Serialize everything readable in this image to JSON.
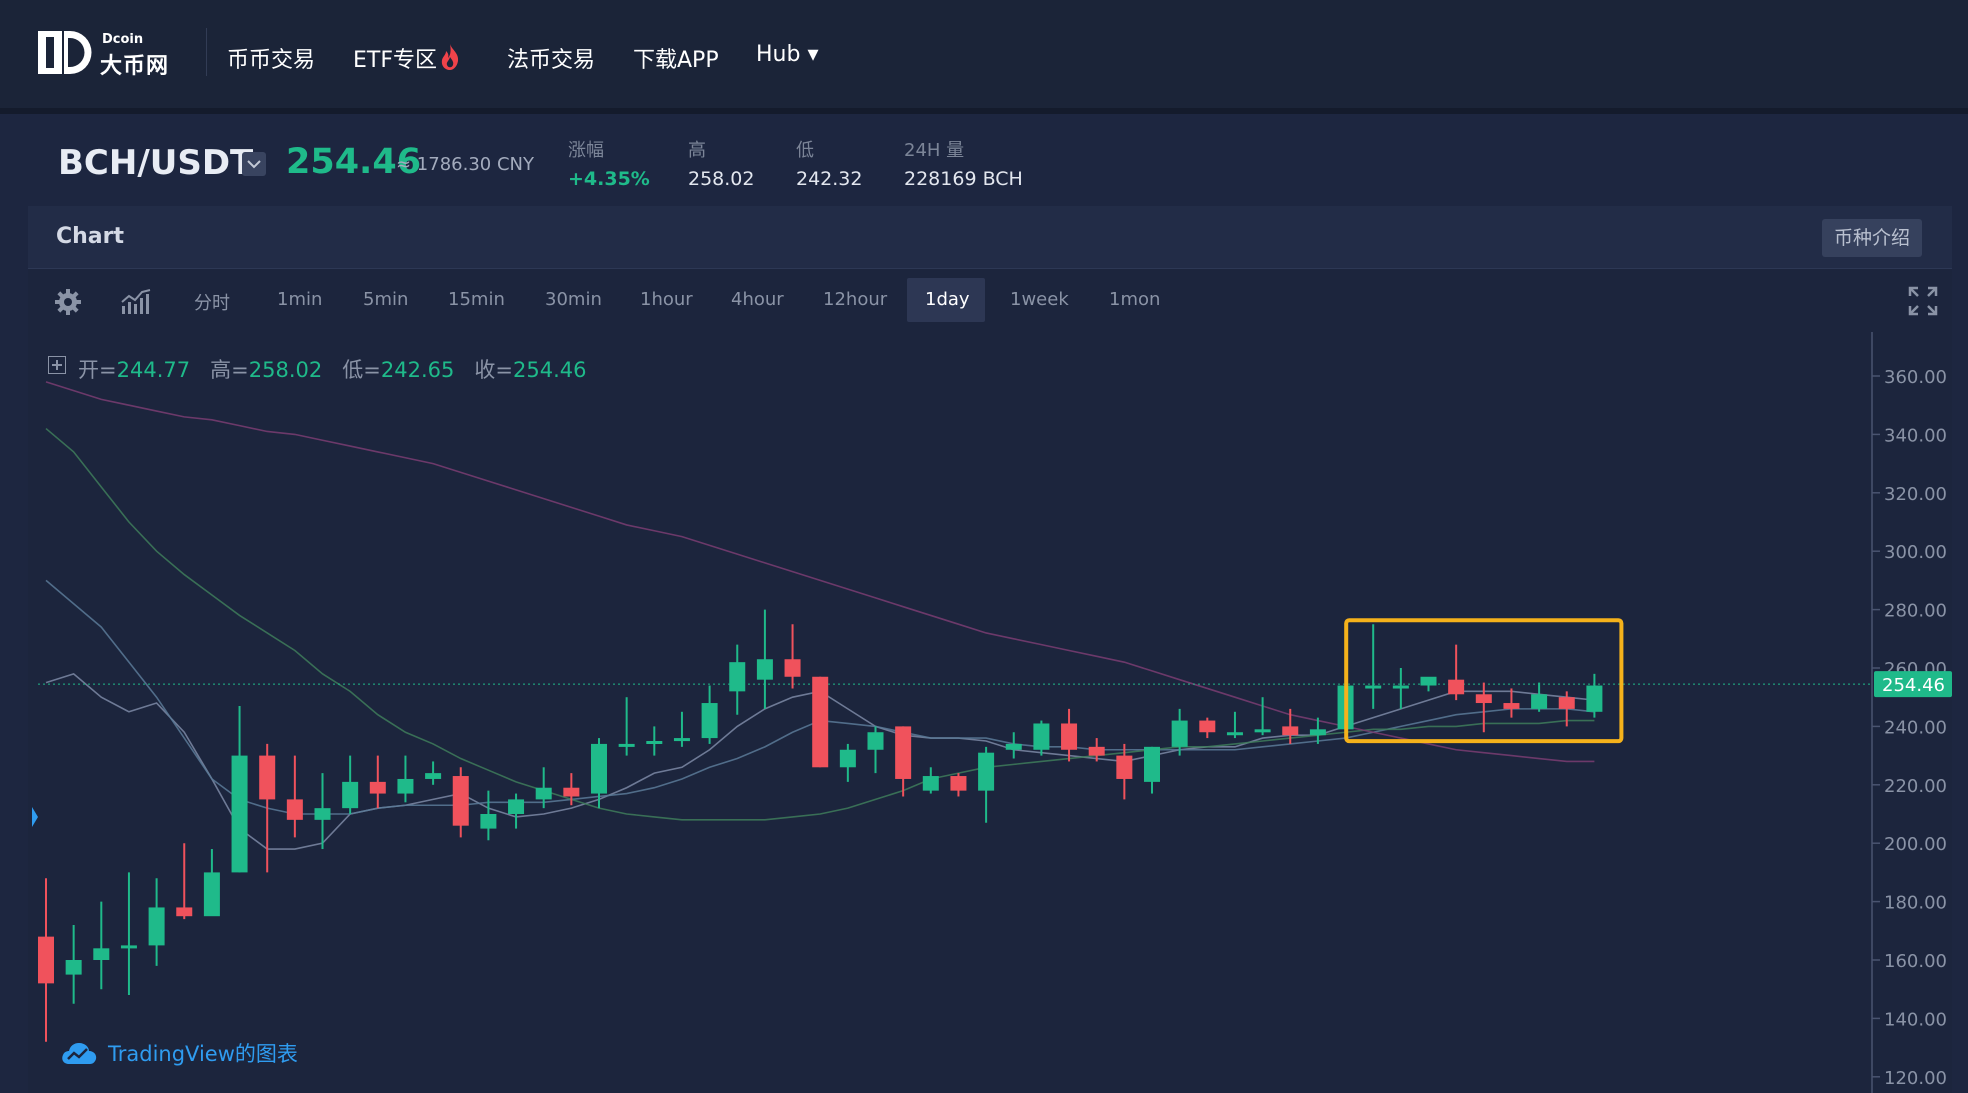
{
  "nav": {
    "logo_small": "Dcoin",
    "logo_big": "大币网",
    "items": [
      {
        "label": "币币交易"
      },
      {
        "label": "ETF专区"
      },
      {
        "label": "法币交易"
      },
      {
        "label": "下载APP"
      },
      {
        "label": "Hub ▾"
      }
    ]
  },
  "ticker": {
    "pair": "BCH/USDT",
    "last_price": "254.46",
    "cny": "≈ 1786.30 CNY",
    "change_label": "涨幅",
    "change_value": "+4.35%",
    "high_label": "高",
    "high_value": "258.02",
    "low_label": "低",
    "low_value": "242.32",
    "vol_label": "24H 量",
    "vol_value": "228169 BCH"
  },
  "chart_panel": {
    "title": "Chart",
    "intro_button": "币种介绍",
    "intervals": [
      "分时",
      "1min",
      "5min",
      "15min",
      "30min",
      "1hour",
      "4hour",
      "12hour",
      "1day",
      "1week",
      "1mon"
    ],
    "active_interval": "1day",
    "legend": {
      "open_label": "开=",
      "open_value": "244.77",
      "high_label": "高=",
      "high_value": "258.02",
      "low_label": "低=",
      "low_value": "242.65",
      "close_label": "收=",
      "close_value": "254.46"
    },
    "watermark": "TradingView的图表",
    "colors": {
      "up": "#1fba8a",
      "down": "#f0525c",
      "highlight": "#f5b21b",
      "ma5": "#7c8aa6",
      "ma10": "#5b7a98",
      "ma30": "#3e7c5a",
      "ma60": "#7a3d72"
    }
  },
  "chart_data": {
    "type": "candlestick",
    "price_axis": [
      "360.00",
      "340.00",
      "320.00",
      "300.00",
      "280.00",
      "260.00",
      "240.00",
      "220.00",
      "200.00",
      "180.00",
      "160.00",
      "140.00",
      "120.00"
    ],
    "last_price_label": "254.46",
    "ylim": [
      120,
      368
    ],
    "candles": [
      {
        "o": 168,
        "h": 188,
        "l": 132,
        "c": 152
      },
      {
        "o": 155,
        "h": 172,
        "l": 145,
        "c": 160
      },
      {
        "o": 160,
        "h": 180,
        "l": 150,
        "c": 164
      },
      {
        "o": 164,
        "h": 190,
        "l": 148,
        "c": 165
      },
      {
        "o": 165,
        "h": 188,
        "l": 158,
        "c": 178
      },
      {
        "o": 178,
        "h": 200,
        "l": 174,
        "c": 175
      },
      {
        "o": 175,
        "h": 198,
        "l": 178,
        "c": 190
      },
      {
        "o": 190,
        "h": 247,
        "l": 190,
        "c": 230
      },
      {
        "o": 230,
        "h": 234,
        "l": 190,
        "c": 215
      },
      {
        "o": 215,
        "h": 230,
        "l": 202,
        "c": 208
      },
      {
        "o": 208,
        "h": 224,
        "l": 198,
        "c": 212
      },
      {
        "o": 212,
        "h": 230,
        "l": 210,
        "c": 221
      },
      {
        "o": 221,
        "h": 230,
        "l": 212,
        "c": 217
      },
      {
        "o": 217,
        "h": 230,
        "l": 214,
        "c": 222
      },
      {
        "o": 222,
        "h": 228,
        "l": 220,
        "c": 224
      },
      {
        "o": 223,
        "h": 226,
        "l": 202,
        "c": 206
      },
      {
        "o": 205,
        "h": 218,
        "l": 201,
        "c": 210
      },
      {
        "o": 210,
        "h": 217,
        "l": 205,
        "c": 215
      },
      {
        "o": 215,
        "h": 226,
        "l": 212,
        "c": 219
      },
      {
        "o": 219,
        "h": 224,
        "l": 213,
        "c": 216
      },
      {
        "o": 217,
        "h": 236,
        "l": 212,
        "c": 234
      },
      {
        "o": 234,
        "h": 250,
        "l": 230,
        "c": 234
      },
      {
        "o": 234,
        "h": 240,
        "l": 230,
        "c": 235
      },
      {
        "o": 235,
        "h": 245,
        "l": 233,
        "c": 236
      },
      {
        "o": 236,
        "h": 254,
        "l": 234,
        "c": 248
      },
      {
        "o": 252,
        "h": 268,
        "l": 244,
        "c": 262
      },
      {
        "o": 256,
        "h": 280,
        "l": 246,
        "c": 263
      },
      {
        "o": 263,
        "h": 275,
        "l": 253,
        "c": 257
      },
      {
        "o": 257,
        "h": 257,
        "l": 226,
        "c": 226
      },
      {
        "o": 226,
        "h": 234,
        "l": 221,
        "c": 232
      },
      {
        "o": 232,
        "h": 240,
        "l": 224,
        "c": 238
      },
      {
        "o": 240,
        "h": 240,
        "l": 216,
        "c": 222
      },
      {
        "o": 218,
        "h": 226,
        "l": 217,
        "c": 223
      },
      {
        "o": 223,
        "h": 224,
        "l": 216,
        "c": 218
      },
      {
        "o": 218,
        "h": 233,
        "l": 207,
        "c": 231
      },
      {
        "o": 232,
        "h": 238,
        "l": 229,
        "c": 234
      },
      {
        "o": 232,
        "h": 242,
        "l": 230,
        "c": 241
      },
      {
        "o": 241,
        "h": 246,
        "l": 228,
        "c": 232
      },
      {
        "o": 233,
        "h": 236,
        "l": 228,
        "c": 230
      },
      {
        "o": 230,
        "h": 234,
        "l": 215,
        "c": 222
      },
      {
        "o": 221,
        "h": 233,
        "l": 217,
        "c": 233
      },
      {
        "o": 233,
        "h": 246,
        "l": 230,
        "c": 242
      },
      {
        "o": 242,
        "h": 243,
        "l": 236,
        "c": 238
      },
      {
        "o": 238,
        "h": 245,
        "l": 236,
        "c": 238
      },
      {
        "o": 238,
        "h": 250,
        "l": 237,
        "c": 239
      },
      {
        "o": 240,
        "h": 246,
        "l": 234,
        "c": 237
      },
      {
        "o": 237,
        "h": 243,
        "l": 234,
        "c": 239
      },
      {
        "o": 239,
        "h": 250,
        "l": 237,
        "c": 254
      },
      {
        "o": 254,
        "h": 275,
        "l": 246,
        "c": 254
      },
      {
        "o": 254,
        "h": 260,
        "l": 246,
        "c": 254
      },
      {
        "o": 254,
        "h": 256,
        "l": 252,
        "c": 257
      },
      {
        "o": 256,
        "h": 268,
        "l": 249,
        "c": 251
      },
      {
        "o": 251,
        "h": 255,
        "l": 238,
        "c": 248
      },
      {
        "o": 248,
        "h": 253,
        "l": 243,
        "c": 246
      },
      {
        "o": 246,
        "h": 255,
        "l": 245,
        "c": 251
      },
      {
        "o": 250,
        "h": 252,
        "l": 240,
        "c": 246
      },
      {
        "o": 245,
        "h": 258,
        "l": 243,
        "c": 254
      }
    ],
    "highlight_range": [
      48,
      56
    ],
    "ma_lines": [
      {
        "name": "ma5",
        "values": [
          255,
          258,
          250,
          245,
          248,
          238,
          222,
          205,
          198,
          198,
          200,
          210,
          212,
          213,
          215,
          217,
          212,
          209,
          210,
          212,
          215,
          219,
          224,
          226,
          232,
          240,
          246,
          250,
          252,
          246,
          240,
          237,
          236,
          236,
          235,
          232,
          231,
          230,
          229,
          228,
          230,
          232,
          233,
          233,
          236,
          237,
          237,
          240,
          243,
          246,
          249,
          252,
          252,
          252,
          251,
          250,
          249
        ]
      },
      {
        "name": "ma10",
        "values": [
          290,
          282,
          274,
          262,
          250,
          236,
          222,
          215,
          212,
          210,
          210,
          210,
          212,
          213,
          213,
          213,
          214,
          214,
          214,
          215,
          216,
          217,
          219,
          222,
          226,
          229,
          233,
          238,
          242,
          241,
          240,
          238,
          236,
          236,
          236,
          234,
          233,
          233,
          232,
          232,
          232,
          232,
          232,
          232,
          233,
          234,
          235,
          236,
          238,
          240,
          242,
          244,
          245,
          246,
          246,
          246,
          245
        ]
      },
      {
        "name": "ma30",
        "values": [
          342,
          334,
          322,
          310,
          300,
          292,
          285,
          278,
          272,
          266,
          258,
          252,
          244,
          238,
          234,
          229,
          225,
          221,
          218,
          215,
          212,
          210,
          209,
          208,
          208,
          208,
          208,
          209,
          210,
          212,
          215,
          218,
          222,
          224,
          226,
          227,
          228,
          229,
          230,
          231,
          232,
          233,
          233,
          234,
          235,
          236,
          237,
          238,
          239,
          239,
          240,
          240,
          241,
          241,
          241,
          242,
          242
        ]
      },
      {
        "name": "ma60",
        "values": [
          358,
          355,
          352,
          350,
          348,
          346,
          345,
          343,
          341,
          340,
          338,
          336,
          334,
          332,
          330,
          327,
          324,
          321,
          318,
          315,
          312,
          309,
          307,
          305,
          302,
          299,
          296,
          293,
          290,
          287,
          284,
          281,
          278,
          275,
          272,
          270,
          268,
          266,
          264,
          262,
          259,
          256,
          253,
          250,
          247,
          244,
          242,
          240,
          238,
          236,
          234,
          232,
          231,
          230,
          229,
          228,
          228
        ]
      }
    ]
  }
}
